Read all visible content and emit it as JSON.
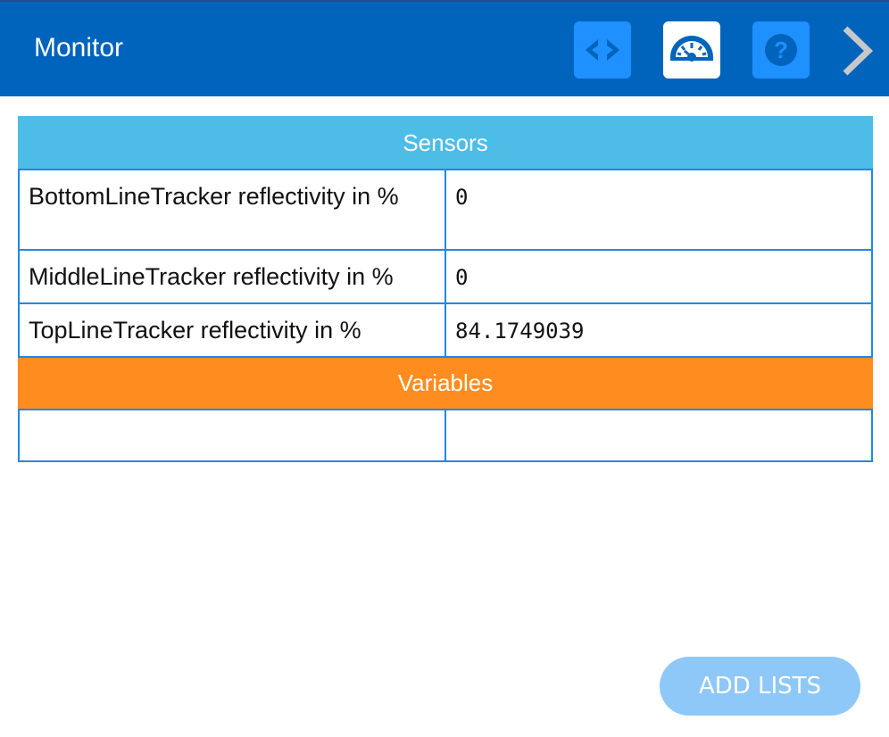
{
  "header": {
    "title": "Monitor",
    "icons": [
      "code-icon",
      "gauge-icon",
      "help-icon",
      "chevron-right-icon"
    ],
    "colors": {
      "bar": "#0064bc",
      "button": "#1e90ff"
    }
  },
  "sensors": {
    "heading": "Sensors",
    "rows": [
      {
        "label": "BottomLineTracker reflectivity in %",
        "value": "0"
      },
      {
        "label": "MiddleLineTracker reflectivity in %",
        "value": "0"
      },
      {
        "label": "TopLineTracker reflectivity in %",
        "value": "84.1749039"
      }
    ],
    "color": "#4dbde8"
  },
  "variables": {
    "heading": "Variables",
    "rows": [
      {
        "label": "",
        "value": ""
      }
    ],
    "color": "#ff8c1e"
  },
  "footer": {
    "add_lists_label": "ADD LISTS"
  }
}
